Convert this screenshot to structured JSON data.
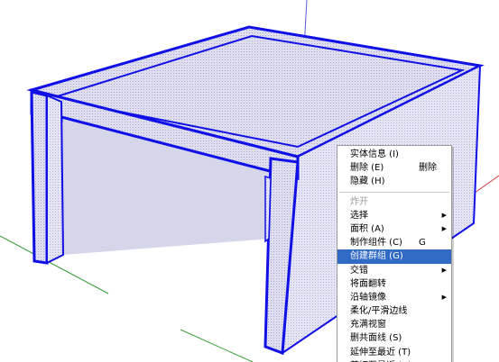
{
  "viewport": {
    "axis_colors": {
      "blue": "#5a5ad8",
      "red": "#cc3a3a",
      "green": "#3c9e3c"
    },
    "edge_color": "#1010e6",
    "face_color": "#d8d8ee"
  },
  "context_menu": {
    "items": [
      {
        "label": "实体信息 (I)"
      },
      {
        "label": "删除 (E)",
        "shortcut": "删除"
      },
      {
        "label": "隐藏 (H)"
      },
      {
        "separator": true
      },
      {
        "label": "炸开",
        "disabled": true
      },
      {
        "label": "选择",
        "submenu": true
      },
      {
        "label": "面积 (A)",
        "submenu": true
      },
      {
        "label": "制作组件 (C)",
        "shortcut": "G"
      },
      {
        "label": "创建群组 (G)",
        "highlighted": true
      },
      {
        "label": "交错",
        "submenu": true
      },
      {
        "label": "将面翻转"
      },
      {
        "label": "沿轴镜像",
        "submenu": true
      },
      {
        "label": "柔化/平滑边线"
      },
      {
        "label": "充满视窗"
      },
      {
        "label": "删共面线 (S)"
      },
      {
        "label": "延伸至最近 (T)"
      },
      {
        "label": "剪切至最近 (R)"
      }
    ]
  }
}
